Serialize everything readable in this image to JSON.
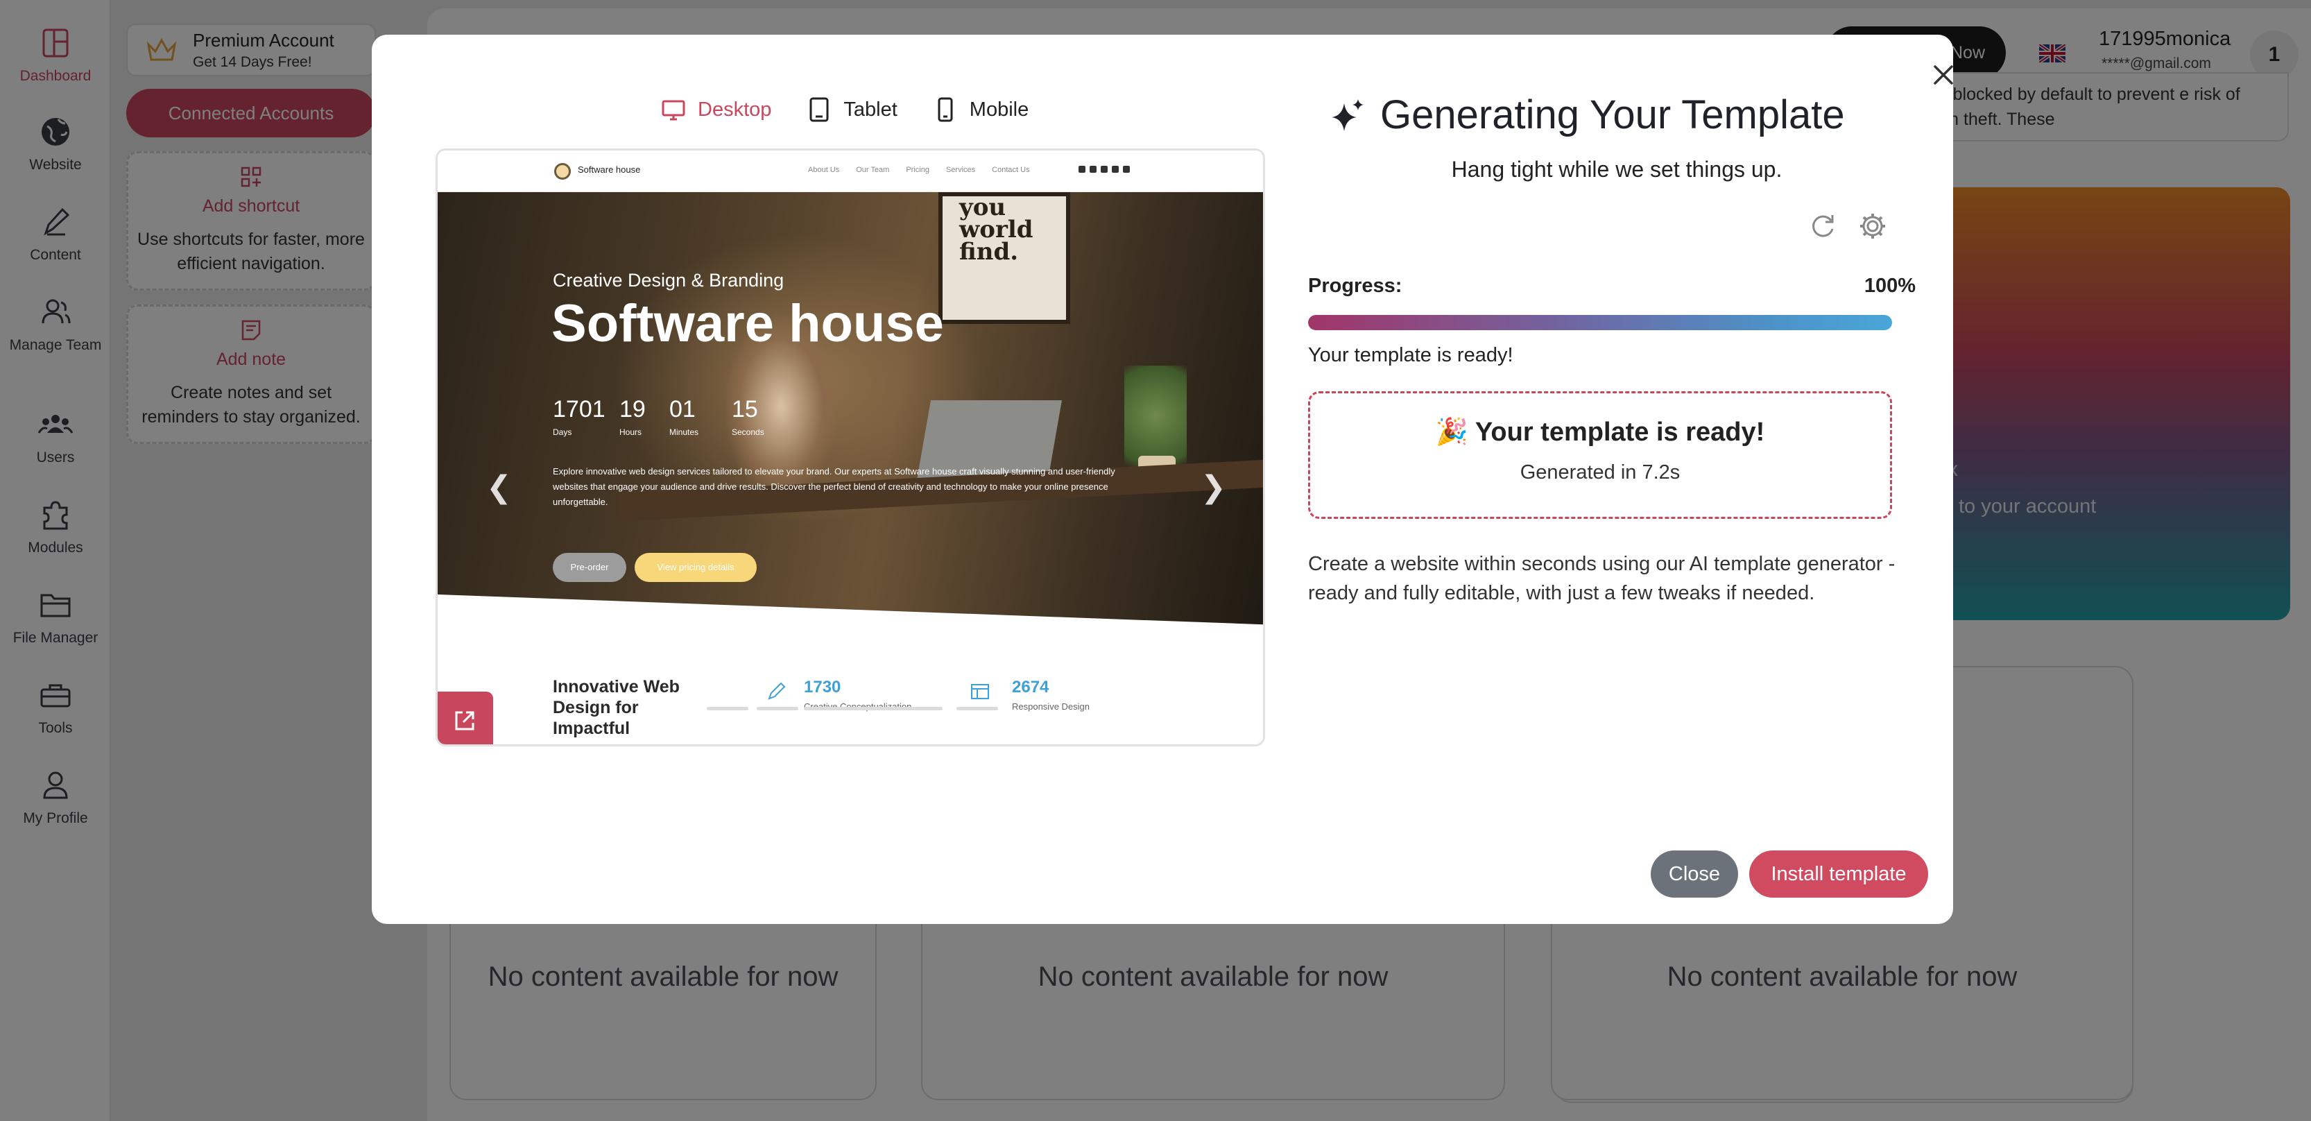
{
  "colors": {
    "accent": "#c8475d",
    "dark": "#1f2229",
    "muted_button": "#6c727a"
  },
  "sidebar": {
    "items": [
      {
        "label": "Dashboard",
        "icon": "dashboard-icon",
        "active": true
      },
      {
        "label": "Website",
        "icon": "globe-icon"
      },
      {
        "label": "Content",
        "icon": "pen-icon"
      },
      {
        "label": "Manage Team",
        "icon": "team-icon"
      },
      {
        "label": "Users",
        "icon": "users-icon"
      },
      {
        "label": "Modules",
        "icon": "puzzle-icon"
      },
      {
        "label": "File Manager",
        "icon": "folder-icon"
      },
      {
        "label": "Tools",
        "icon": "toolbox-icon"
      },
      {
        "label": "My Profile",
        "icon": "profile-icon"
      }
    ]
  },
  "account": {
    "title": "Premium Account",
    "subtitle": "Get 14 Days Free!",
    "connected_label": "Connected Accounts"
  },
  "shortcuts": {
    "title": "Add shortcut",
    "text": "Use shortcuts for faster, more efficient navigation."
  },
  "notes": {
    "title": "Add note",
    "text": "Create notes and set reminders to stay organized."
  },
  "header": {
    "pill_label": "Now",
    "user_name": "171995monica",
    "user_email": "*****@gmail.com",
    "user_badge": "1"
  },
  "notice": {
    "text": "e now blocked by default to prevent e risk of domain theft. These"
  },
  "promo": {
    "mark": "x",
    "text": "to your account"
  },
  "empty_cards": [
    "No content available for now",
    "No content available for now",
    "No content available for now"
  ],
  "modal": {
    "close_icon": "close-icon",
    "device_tabs": [
      {
        "label": "Desktop",
        "icon": "desktop-icon",
        "active": true
      },
      {
        "label": "Tablet",
        "icon": "tablet-icon"
      },
      {
        "label": "Mobile",
        "icon": "mobile-icon"
      }
    ],
    "preview": {
      "brand": "Software house",
      "nav_links": [
        "About Us",
        "Our Team",
        "Pricing",
        "Services",
        "Contact Us"
      ],
      "frame_text": "you world find.",
      "eyebrow": "Creative Design & Branding",
      "title": "Software house",
      "countdown": [
        {
          "value": "1701",
          "label": "Days"
        },
        {
          "value": "19",
          "label": "Hours"
        },
        {
          "value": "01",
          "label": "Minutes"
        },
        {
          "value": "15",
          "label": "Seconds"
        }
      ],
      "description": "Explore innovative web design services tailored to elevate your brand. Our experts at Software house craft visually stunning and user-friendly websites that engage your audience and drive results. Discover the perfect blend of creativity and technology to make your online presence unforgettable.",
      "btn_primary": "Pre-order",
      "btn_secondary": "View pricing details",
      "section_title": "Innovative Web Design for Impactful",
      "stats": [
        {
          "value": "1730",
          "label": "Creative Conceptualization",
          "icon": "pencil-icon"
        },
        {
          "value": "2674",
          "label": "Responsive Design",
          "icon": "layout-icon"
        }
      ]
    },
    "title": "Generating Your Template",
    "subtitle": "Hang tight while we set things up.",
    "progress_label": "Progress:",
    "progress_value": "100%",
    "progress_fraction": 1.0,
    "status": "Your template is ready!",
    "ready_title": "🎉 Your template is ready!",
    "ready_sub": "Generated in 7.2s",
    "description": "Create a website within seconds using our AI template generator - ready and fully editable, with just a few tweaks if needed.",
    "close_label": "Close",
    "install_label": "Install template"
  }
}
